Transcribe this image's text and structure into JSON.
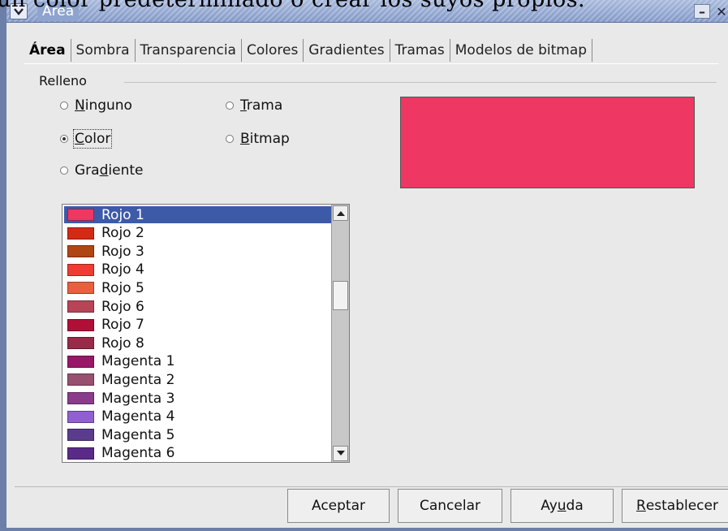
{
  "caption": "un color predeterminado o crear los suyos propios.",
  "window": {
    "title": "Área",
    "minimize_glyph": "–",
    "close_glyph": "✕"
  },
  "tabs": [
    {
      "label": "Área",
      "active": true
    },
    {
      "label": "Sombra"
    },
    {
      "label": "Transparencia"
    },
    {
      "label": "Colores"
    },
    {
      "label": "Gradientes"
    },
    {
      "label": "Tramas"
    },
    {
      "label": "Modelos de bitmap"
    }
  ],
  "fill": {
    "group_label": "Relleno",
    "options": [
      {
        "pre": "",
        "u": "N",
        "post": "inguno",
        "selected": false
      },
      {
        "pre": "",
        "u": "T",
        "post": "rama",
        "selected": false
      },
      {
        "pre": "",
        "u": "C",
        "post": "olor",
        "selected": true
      },
      {
        "pre": "",
        "u": "B",
        "post": "itmap",
        "selected": false
      },
      {
        "pre": "Gra",
        "u": "d",
        "post": "iente",
        "selected": false
      }
    ]
  },
  "preview_color": "#ee3762",
  "colors": [
    {
      "name": "Rojo 1",
      "color": "#ee3762",
      "selected": true
    },
    {
      "name": "Rojo 2",
      "color": "#d42a14"
    },
    {
      "name": "Rojo 3",
      "color": "#b04614"
    },
    {
      "name": "Rojo 4",
      "color": "#f03b32"
    },
    {
      "name": "Rojo 5",
      "color": "#e8603e"
    },
    {
      "name": "Rojo 6",
      "color": "#b84458"
    },
    {
      "name": "Rojo 7",
      "color": "#b01038"
    },
    {
      "name": "Rojo 8",
      "color": "#9a2a48"
    },
    {
      "name": "Magenta 1",
      "color": "#981868"
    },
    {
      "name": "Magenta 2",
      "color": "#985070"
    },
    {
      "name": "Magenta 3",
      "color": "#8a3c8a"
    },
    {
      "name": "Magenta 4",
      "color": "#9060d0"
    },
    {
      "name": "Magenta 5",
      "color": "#5a3c8c"
    },
    {
      "name": "Magenta 6",
      "color": "#5a2a88"
    }
  ],
  "buttons": {
    "ok": "Aceptar",
    "cancel": "Cancelar",
    "help_pre": "Ay",
    "help_u": "u",
    "help_post": "da",
    "reset_u": "R",
    "reset_post": "establecer"
  }
}
